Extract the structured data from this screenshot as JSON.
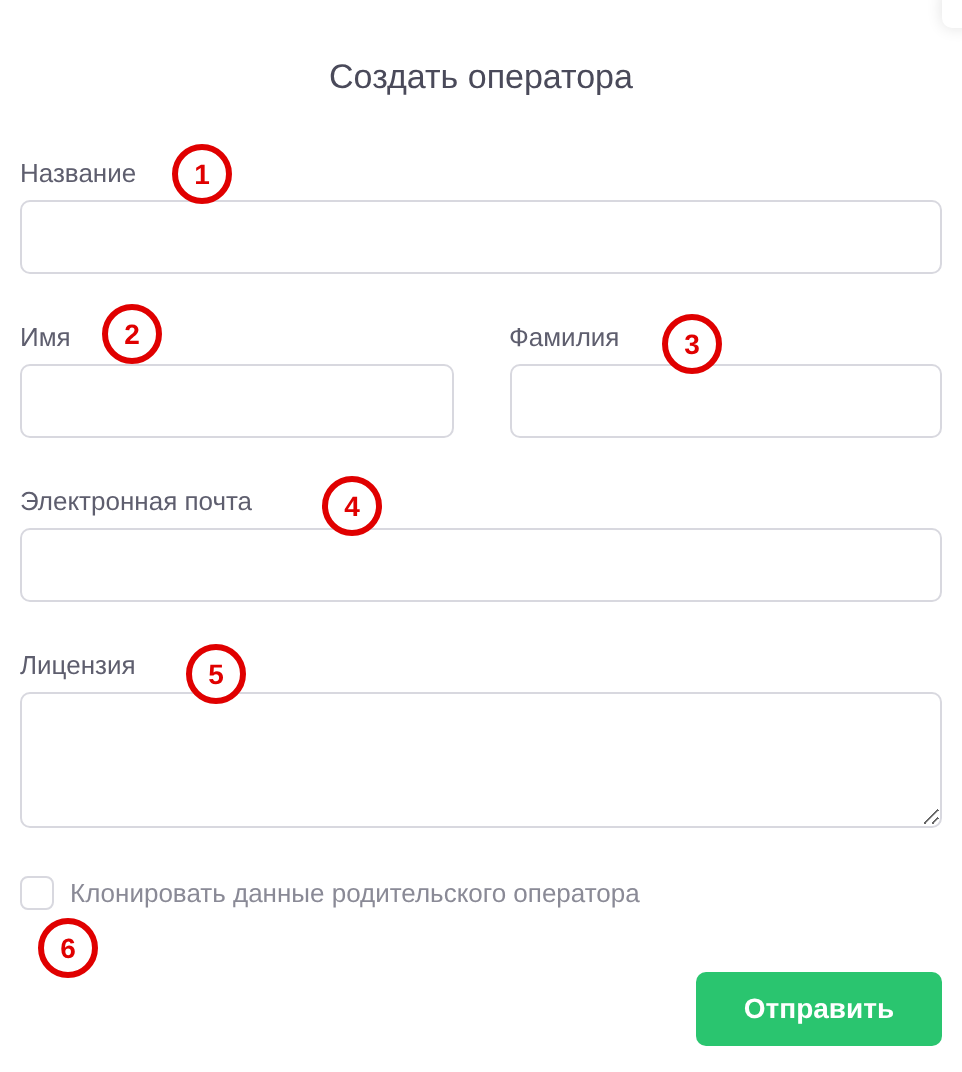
{
  "title": "Создать оператора",
  "fields": [
    {
      "kind": "text",
      "label": "Название",
      "marker": "1"
    },
    {
      "kind": "text",
      "label": "Имя",
      "marker": "2"
    },
    {
      "kind": "text",
      "label": "Фамилия",
      "marker": "3"
    },
    {
      "kind": "text",
      "label": "Электронная почта",
      "marker": "4"
    },
    {
      "kind": "textarea",
      "label": "Лицензия",
      "marker": "5"
    }
  ],
  "checkbox": {
    "label": "Клонировать данные родительского оператора",
    "checked": false,
    "marker": "6"
  },
  "submit": "Отправить"
}
